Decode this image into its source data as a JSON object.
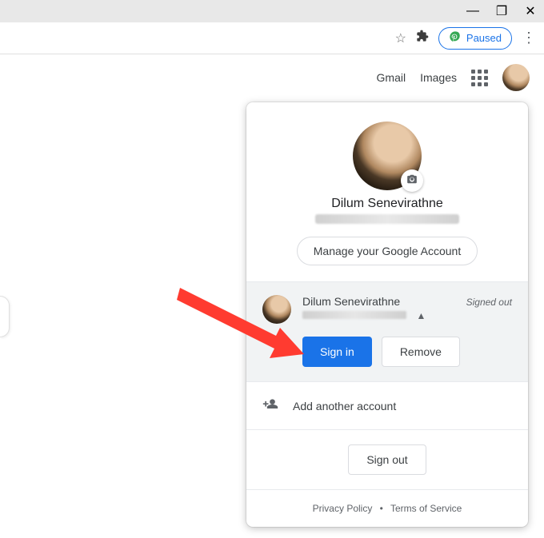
{
  "window": {
    "minimize": "—",
    "maximize": "❐",
    "close": "✕"
  },
  "toolbar": {
    "paused": "Paused"
  },
  "header": {
    "gmail": "Gmail",
    "images": "Images"
  },
  "popup": {
    "name": "Dilum Senevirathne",
    "manage": "Manage your Google Account",
    "account": {
      "name": "Dilum Senevirathne",
      "status": "Signed out",
      "signin": "Sign in",
      "remove": "Remove"
    },
    "add_another": "Add another account",
    "signout": "Sign out",
    "footer": {
      "privacy": "Privacy Policy",
      "terms": "Terms of Service"
    }
  }
}
